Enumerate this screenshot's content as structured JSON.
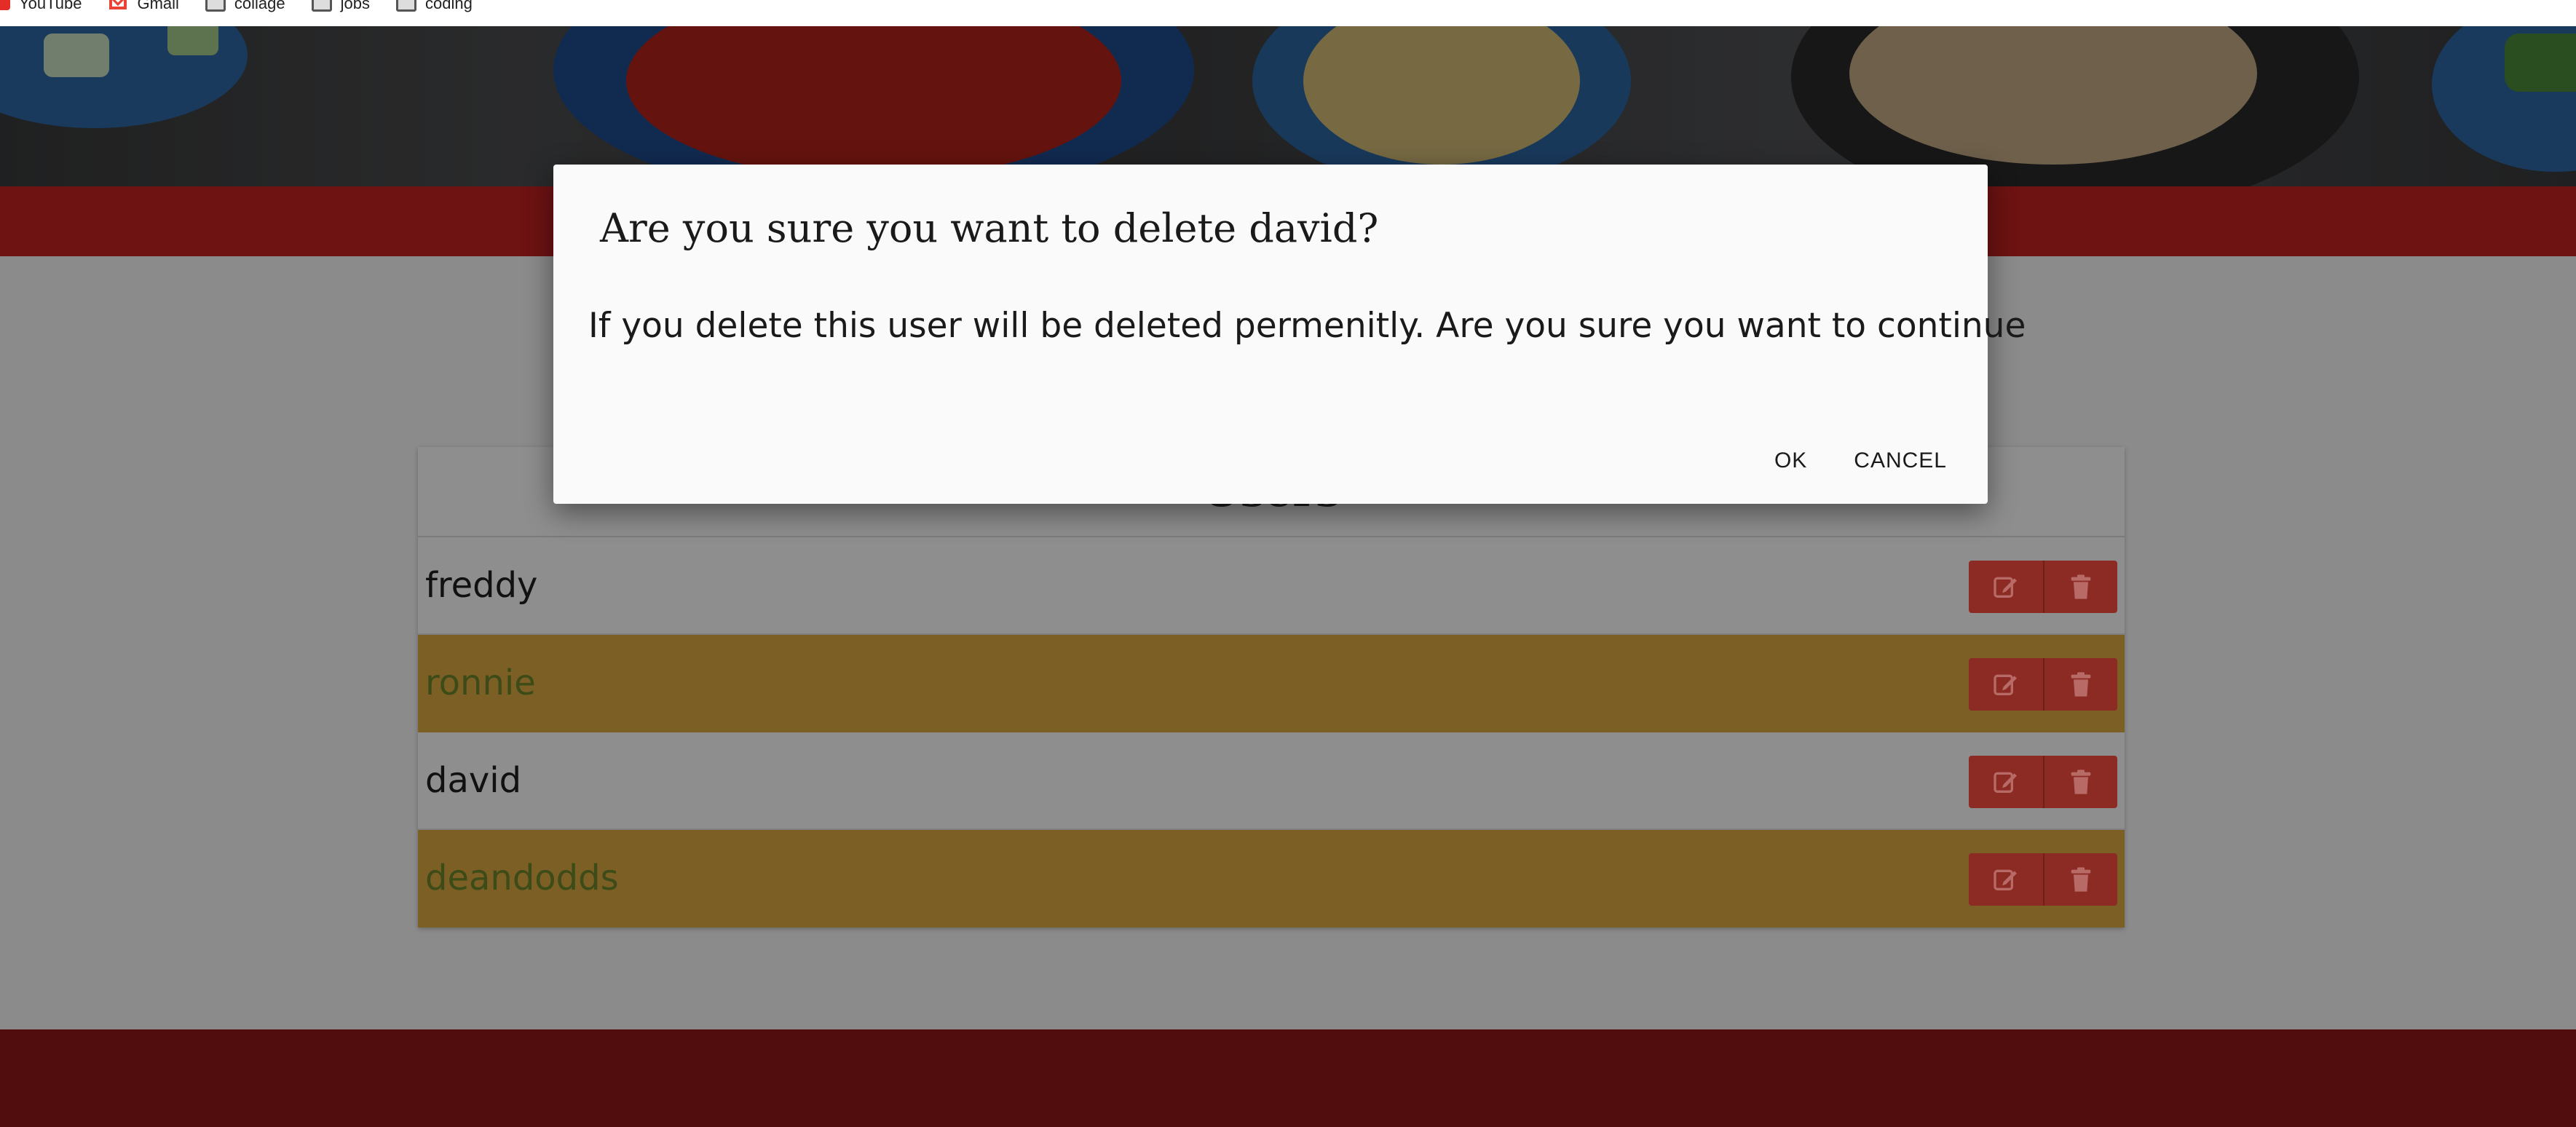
{
  "bookmarks": [
    {
      "label": "YouTube",
      "icon": "youtube-icon"
    },
    {
      "label": "Gmail",
      "icon": "gmail-icon"
    },
    {
      "label": "collage",
      "icon": "folder-icon"
    },
    {
      "label": "jobs",
      "icon": "folder-icon"
    },
    {
      "label": "coding",
      "icon": "folder-icon"
    }
  ],
  "users_card": {
    "title": "Users",
    "rows": [
      {
        "name": "freddy"
      },
      {
        "name": "ronnie"
      },
      {
        "name": "david"
      },
      {
        "name": "deandodds"
      }
    ],
    "edit_icon": "pencil-square-icon",
    "delete_icon": "trash-icon"
  },
  "dialog": {
    "title": "Are you sure you want to delete david?",
    "body": "If you delete this user will be deleted permenitly. Are you sure you want to continue",
    "ok_label": "OK",
    "cancel_label": "CANCEL"
  },
  "colors": {
    "header_red": "#c8102e",
    "alt_row": "#f5c242",
    "action_button": "#d9433b",
    "footer": "#7a1414"
  }
}
